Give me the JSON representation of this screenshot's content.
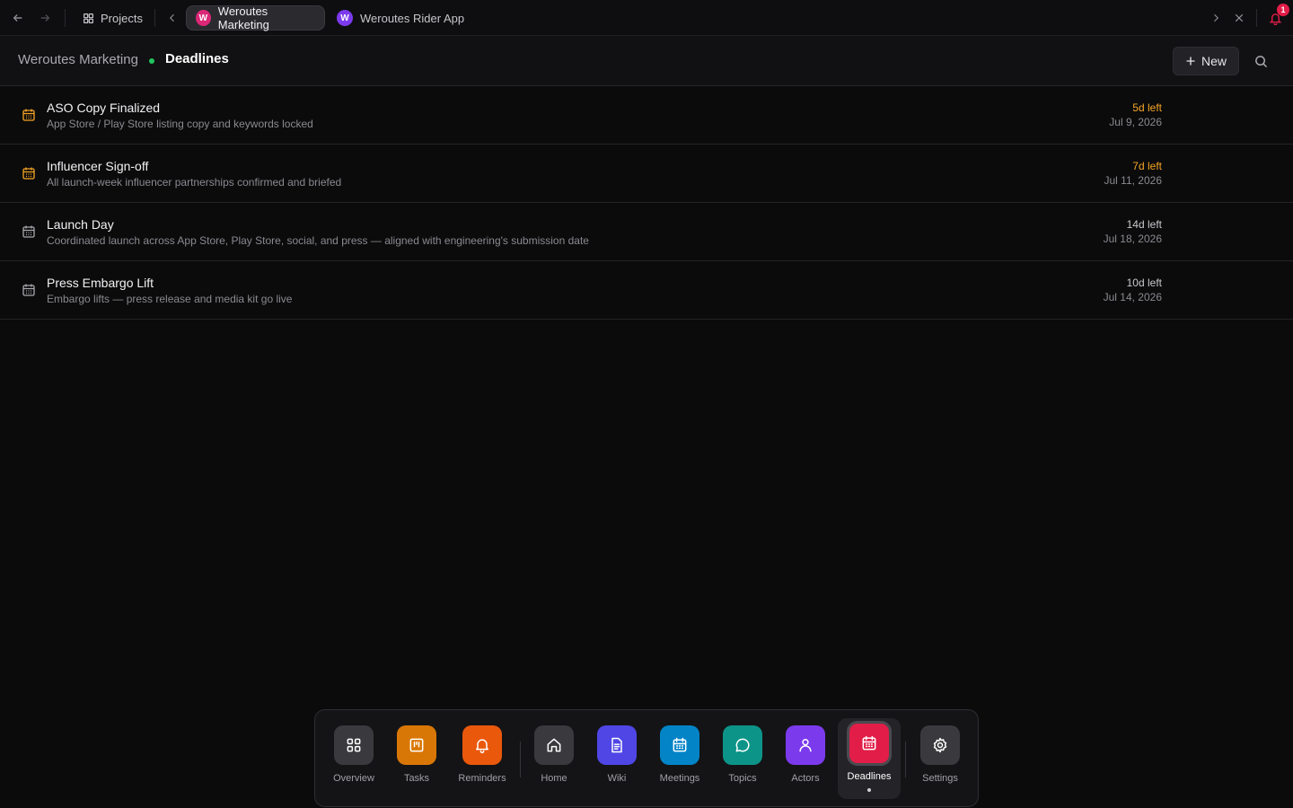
{
  "topbar": {
    "projects_label": "Projects",
    "tabs": [
      {
        "label": "Weroutes Marketing",
        "avatar": "W",
        "avatar_color": "#db2777",
        "active": true
      },
      {
        "label": "Weroutes Rider App",
        "avatar": "W",
        "avatar_color": "#7c3aed",
        "active": false
      }
    ],
    "notification_count": "1"
  },
  "header": {
    "breadcrumb_parent": "Weroutes Marketing",
    "breadcrumb_current": "Deadlines",
    "new_label": "New"
  },
  "deadlines": [
    {
      "title": "ASO Copy Finalized",
      "description": "App Store / Play Store listing copy and keywords locked",
      "time_left": "5d left",
      "date": "Jul 9, 2026",
      "urgent": true
    },
    {
      "title": "Influencer Sign-off",
      "description": "All launch-week influencer partnerships confirmed and briefed",
      "time_left": "7d left",
      "date": "Jul 11, 2026",
      "urgent": true
    },
    {
      "title": "Launch Day",
      "description": "Coordinated launch across App Store, Play Store, social, and press — aligned with engineering's submission date",
      "time_left": "14d left",
      "date": "Jul 18, 2026",
      "urgent": false
    },
    {
      "title": "Press Embargo Lift",
      "description": "Embargo lifts — press release and media kit go live",
      "time_left": "10d left",
      "date": "Jul 14, 2026",
      "urgent": false
    }
  ],
  "colors": {
    "urgent": "#f5a524",
    "normal": "#a9a9ae"
  },
  "dock": [
    {
      "label": "Overview",
      "icon": "grid-icon",
      "color": "#3a3a3e"
    },
    {
      "label": "Tasks",
      "icon": "kanban-icon",
      "color": "#d97706"
    },
    {
      "label": "Reminders",
      "icon": "bell-icon",
      "color": "#ea580c"
    },
    {
      "label": "Home",
      "icon": "home-icon",
      "color": "#3a3a3e"
    },
    {
      "label": "Wiki",
      "icon": "document-icon",
      "color": "#4f46e5"
    },
    {
      "label": "Meetings",
      "icon": "calendar-icon",
      "color": "#0284c7"
    },
    {
      "label": "Topics",
      "icon": "chat-icon",
      "color": "#0d9488"
    },
    {
      "label": "Actors",
      "icon": "person-icon",
      "color": "#7c3aed"
    },
    {
      "label": "Deadlines",
      "icon": "calendar-icon",
      "color": "#e11d48",
      "active": true
    },
    {
      "label": "Settings",
      "icon": "gear-icon",
      "color": "#3a3a3e"
    }
  ]
}
